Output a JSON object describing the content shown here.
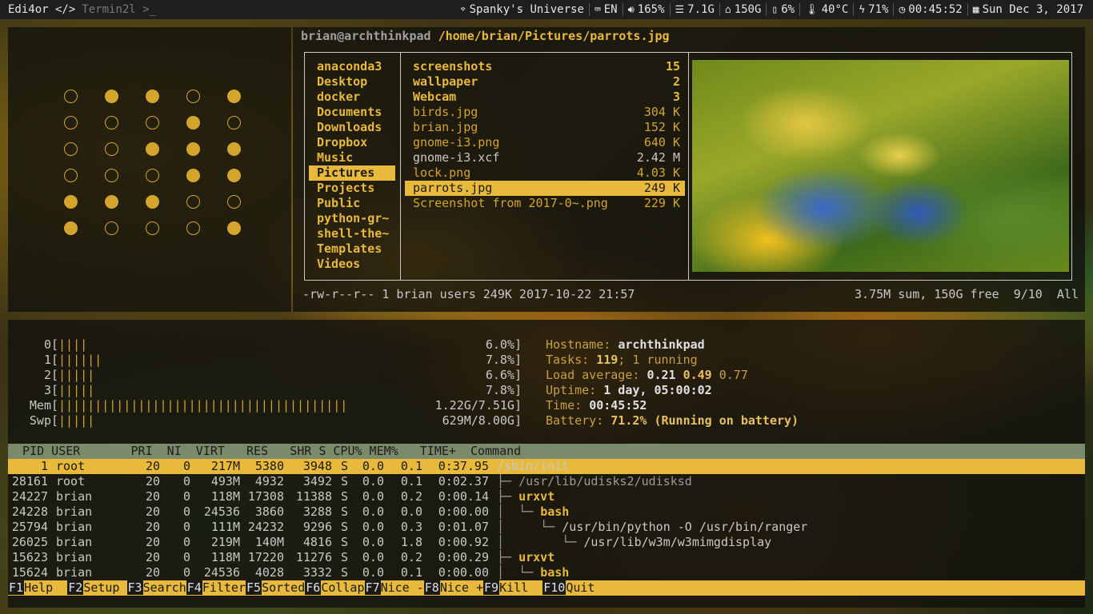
{
  "topbar": {
    "workspaces": [
      "Edi4or </>",
      "Termin2l >_"
    ],
    "wifi": "Spanky's Universe",
    "keyboard": "EN",
    "volume": "165%",
    "disk": "7.1G",
    "home": "150G",
    "memory": "6%",
    "temperature": "40°C",
    "battery": "71%",
    "uptime": "00:45:52",
    "date": "Sun Dec  3, 2017"
  },
  "clock_dots": [
    [
      0,
      1,
      1,
      0,
      1
    ],
    [
      0,
      0,
      0,
      1,
      0
    ],
    [
      0,
      0,
      1,
      1,
      1
    ],
    [
      0,
      0,
      0,
      1,
      1
    ],
    [
      1,
      1,
      1,
      0,
      0
    ],
    [
      1,
      0,
      0,
      0,
      1
    ]
  ],
  "ranger": {
    "user": "brian@archthinkpad",
    "path": "/home/brian/Pictures/parrots.jpg",
    "col1": [
      "anaconda3",
      "Desktop",
      "docker",
      "Documents",
      "Downloads",
      "Dropbox",
      "Music",
      "Pictures",
      "Projects",
      "Public",
      "python-gr~",
      "shell-the~",
      "Templates",
      "Videos"
    ],
    "col1_selected": 7,
    "files": [
      {
        "name": "screenshots",
        "size": "15",
        "type": "dir"
      },
      {
        "name": "wallpaper",
        "size": "2",
        "type": "dir"
      },
      {
        "name": "Webcam",
        "size": "3",
        "type": "dir"
      },
      {
        "name": "birds.jpg",
        "size": "304 K",
        "type": "img"
      },
      {
        "name": "brian.jpg",
        "size": "152 K",
        "type": "img"
      },
      {
        "name": "gnome-i3.png",
        "size": "640 K",
        "type": "img"
      },
      {
        "name": "gnome-i3.xcf",
        "size": "2.42 M",
        "type": "plain"
      },
      {
        "name": "lock.png",
        "size": "4.03 K",
        "type": "img"
      },
      {
        "name": "parrots.jpg",
        "size": "249 K",
        "type": "sel"
      },
      {
        "name": "Screenshot from 2017-0~.png",
        "size": "229 K",
        "type": "img"
      }
    ],
    "status_left": "-rw-r--r-- 1 brian users 249K 2017-10-22 21:57",
    "status_right": "3.75M sum, 150G free  9/10  All"
  },
  "htop": {
    "meters": [
      {
        "label": "0",
        "bar": "||||",
        "value": "6.0%]"
      },
      {
        "label": "1",
        "bar": "||||||",
        "value": "7.8%]"
      },
      {
        "label": "2",
        "bar": "|||||",
        "value": "6.6%]"
      },
      {
        "label": "3",
        "bar": "|||||",
        "value": "7.8%]"
      },
      {
        "label": "Mem",
        "bar": "||||||||||||||||||||||||||||||||||||||||",
        "value": "1.22G/7.51G]"
      },
      {
        "label": "Swp",
        "bar": "|||||",
        "value": "629M/8.00G]"
      }
    ],
    "sysinfo": {
      "hostname_label": "Hostname: ",
      "hostname": "archthinkpad",
      "tasks_label": "Tasks: ",
      "tasks": "119",
      "tasks_rest": "; 1 running",
      "load_label": "Load average: ",
      "load1": "0.21",
      "load5": "0.49",
      "load15": "0.77",
      "uptime_label": "Uptime: ",
      "uptime": "1 day, 05:00:02",
      "time_label": "Time: ",
      "time": "00:45:52",
      "battery_label": "Battery: ",
      "battery": "71.2% (Running on battery)"
    },
    "header": "  PID USER       PRI  NI  VIRT   RES   SHR S CPU% MEM%   TIME+  Command",
    "processes": [
      {
        "pid": "1",
        "user": "root",
        "pri": "20",
        "ni": "0",
        "virt": "217M",
        "res": "5380",
        "shr": "3948",
        "s": "S",
        "cpu": "0.0",
        "mem": "0.1",
        "time": "0:37.95",
        "tree": "",
        "cmd": "/sbin/init",
        "cmd_style": "w"
      },
      {
        "pid": "28161",
        "user": "root",
        "pri": "20",
        "ni": "0",
        "virt": "493M",
        "res": "4932",
        "shr": "3492",
        "s": "S",
        "cpu": "0.0",
        "mem": "0.1",
        "time": "0:02.37",
        "tree": "├─ ",
        "cmd": "/usr/lib/udisks2/udisksd",
        "cmd_style": "dim"
      },
      {
        "pid": "24227",
        "user": "brian",
        "pri": "20",
        "ni": "0",
        "virt": "118M",
        "res": "17308",
        "shr": "11388",
        "s": "S",
        "cpu": "0.0",
        "mem": "0.2",
        "time": "0:00.14",
        "tree": "├─ ",
        "cmd": "urxvt",
        "cmd_style": "hi"
      },
      {
        "pid": "24228",
        "user": "brian",
        "pri": "20",
        "ni": "0",
        "virt": "24536",
        "res": "3860",
        "shr": "3288",
        "s": "S",
        "cpu": "0.0",
        "mem": "0.0",
        "time": "0:00.00",
        "tree": "│  └─ ",
        "cmd": "bash",
        "cmd_style": "hi"
      },
      {
        "pid": "25794",
        "user": "brian",
        "pri": "20",
        "ni": "0",
        "virt": "111M",
        "res": "24232",
        "shr": "9296",
        "s": "S",
        "cpu": "0.0",
        "mem": "0.3",
        "time": "0:01.07",
        "tree": "│     └─ ",
        "cmd": "/usr/bin/python -O /usr/bin/ranger",
        "cmd_style": "py"
      },
      {
        "pid": "26025",
        "user": "brian",
        "pri": "20",
        "ni": "0",
        "virt": "219M",
        "res": "140M",
        "shr": "4816",
        "s": "S",
        "cpu": "0.0",
        "mem": "1.8",
        "time": "0:00.92",
        "tree": "│        └─ ",
        "cmd": "/usr/lib/w3m/w3mimgdisplay",
        "cmd_style": "w3m"
      },
      {
        "pid": "15623",
        "user": "brian",
        "pri": "20",
        "ni": "0",
        "virt": "118M",
        "res": "17220",
        "shr": "11276",
        "s": "S",
        "cpu": "0.0",
        "mem": "0.2",
        "time": "0:00.29",
        "tree": "├─ ",
        "cmd": "urxvt",
        "cmd_style": "hi"
      },
      {
        "pid": "15624",
        "user": "brian",
        "pri": "20",
        "ni": "0",
        "virt": "24536",
        "res": "4028",
        "shr": "3332",
        "s": "S",
        "cpu": "0.0",
        "mem": "0.1",
        "time": "0:00.00",
        "tree": "│  └─ ",
        "cmd": "bash",
        "cmd_style": "hi"
      }
    ],
    "fkeys": [
      {
        "key": "F1",
        "label": "Help  "
      },
      {
        "key": "F2",
        "label": "Setup "
      },
      {
        "key": "F3",
        "label": "Search"
      },
      {
        "key": "F4",
        "label": "Filter"
      },
      {
        "key": "F5",
        "label": "Sorted"
      },
      {
        "key": "F6",
        "label": "Collap"
      },
      {
        "key": "F7",
        "label": "Nice -"
      },
      {
        "key": "F8",
        "label": "Nice +"
      },
      {
        "key": "F9",
        "label": "Kill  "
      },
      {
        "key": "F10",
        "label": "Quit"
      }
    ]
  },
  "colors": {
    "accent": "#e8b93a",
    "dot": "#d4a52c",
    "header_bg": "#7a8a6a"
  }
}
